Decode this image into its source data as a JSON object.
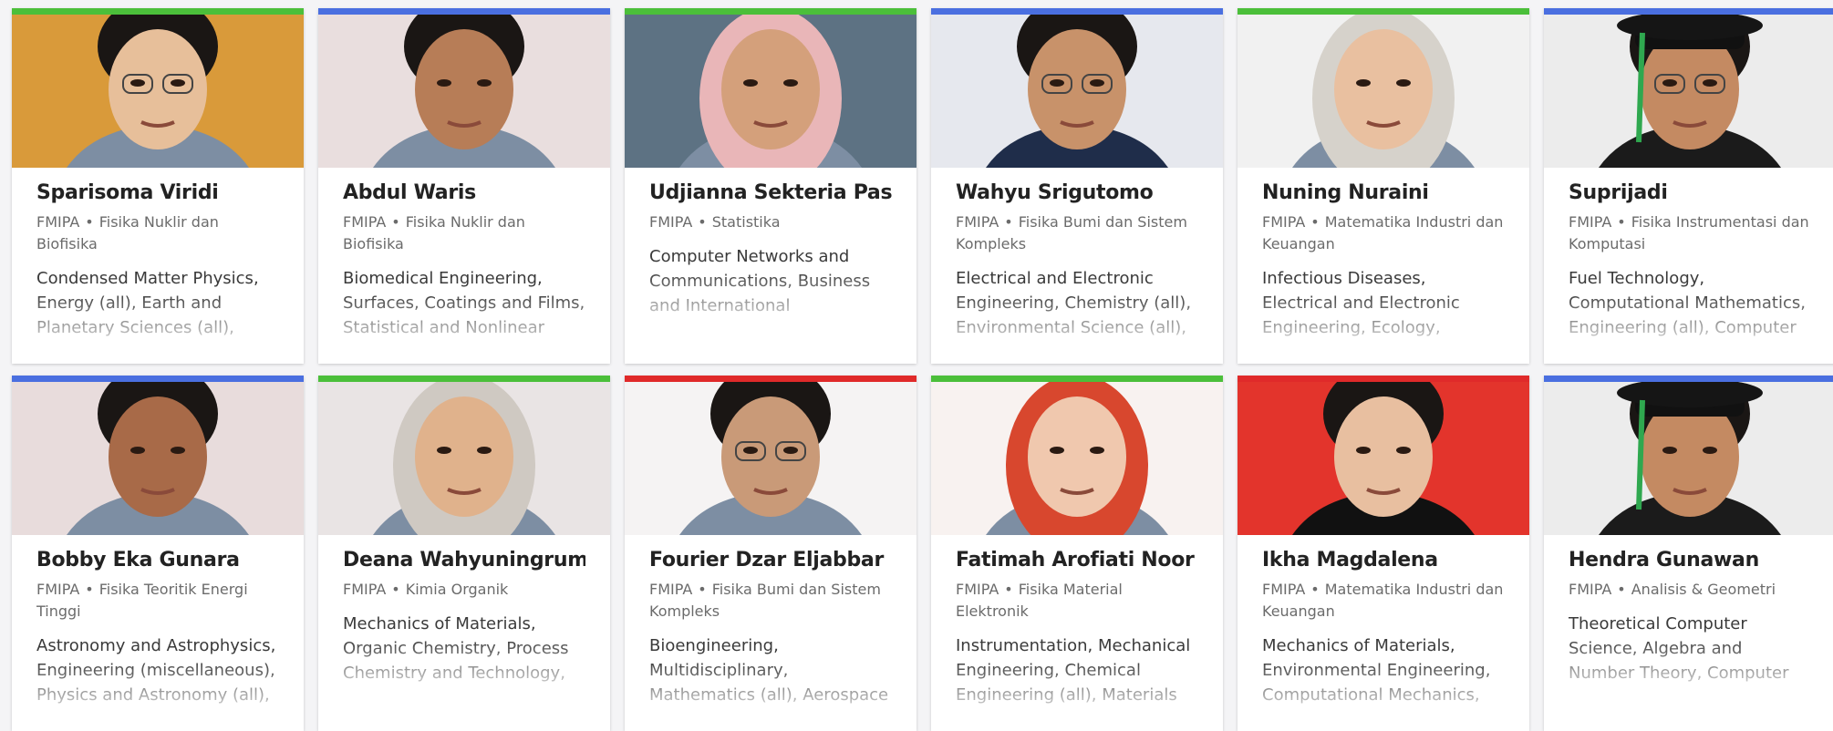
{
  "profiles": [
    {
      "name": "Sparisoma Viridi",
      "faculty": "FMIPA",
      "separator": "•",
      "program": "Fisika Nuklir dan Biofisika",
      "topics": "Condensed Matter Physics, Energy (all), Earth and Planetary Sciences (all),",
      "accent": "#4bbf3a",
      "photo_bg": "#d99a3a"
    },
    {
      "name": "Abdul Waris",
      "faculty": "FMIPA",
      "separator": "•",
      "program": "Fisika Nuklir dan Biofisika",
      "topics": "Biomedical Engineering, Surfaces, Coatings and Films, Statistical and Nonlinear",
      "accent": "#4a6fe0",
      "photo_bg": "#e9dede"
    },
    {
      "name": "Udjianna Sekteria Pasaribu",
      "faculty": "FMIPA",
      "separator": "•",
      "program": "Statistika",
      "topics": "Computer Networks and Communications, Business and International Management, Business,",
      "accent": "#4bbf3a",
      "photo_bg": "#5d7283"
    },
    {
      "name": "Wahyu Srigutomo",
      "faculty": "FMIPA",
      "separator": "•",
      "program": "Fisika Bumi dan Sistem Kompleks",
      "topics": "Electrical and Electronic Engineering, Chemistry (all), Environmental Science (all),",
      "accent": "#4a6fe0",
      "photo_bg": "#e6e8ee"
    },
    {
      "name": "Nuning Nuraini",
      "faculty": "FMIPA",
      "separator": "•",
      "program": "Matematika Industri dan Keuangan",
      "topics": "Infectious Diseases, Electrical and Electronic Engineering, Ecology, Evolution, Behavior",
      "accent": "#4bbf3a",
      "photo_bg": "#f1f1f1"
    },
    {
      "name": "Suprijadi",
      "faculty": "FMIPA",
      "separator": "•",
      "program": "Fisika Instrumentasi dan Komputasi",
      "topics": "Fuel Technology, Computational Mathematics, Engineering (all), Computer",
      "accent": "#4a6fe0",
      "photo_bg": "#ececec"
    },
    {
      "name": "Bobby Eka Gunara",
      "faculty": "FMIPA",
      "separator": "•",
      "program": "Fisika Teoritik Energi Tinggi",
      "topics": "Astronomy and Astrophysics, Engineering (miscellaneous), Physics and Astronomy (all),",
      "accent": "#4a6fe0",
      "photo_bg": "#e8dcdc"
    },
    {
      "name": "Deana Wahyuningrum",
      "faculty": "FMIPA",
      "separator": "•",
      "program": "Kimia Organik",
      "topics": "Mechanics of Materials, Organic Chemistry, Process Chemistry and Technology, Water Science and",
      "accent": "#4bbf3a",
      "photo_bg": "#e9e4e4"
    },
    {
      "name": "Fourier Dzar Eljabbar",
      "faculty": "FMIPA",
      "separator": "•",
      "program": "Fisika Bumi dan Sistem Kompleks",
      "topics": "Bioengineering, Multidisciplinary, Mathematics (all), Aerospace",
      "accent": "#e02a2a",
      "photo_bg": "#f5f3f3"
    },
    {
      "name": "Fatimah Arofiati Noor",
      "faculty": "FMIPA",
      "separator": "•",
      "program": "Fisika Material Elektronik",
      "topics": "Instrumentation, Mechanical Engineering, Chemical Engineering (all), Materials",
      "accent": "#4bbf3a",
      "photo_bg": "#f8f2f0"
    },
    {
      "name": "Ikha Magdalena",
      "faculty": "FMIPA",
      "separator": "•",
      "program": "Matematika Industri dan Keuangan",
      "topics": "Mechanics of Materials, Environmental Engineering, Computational Mechanics,",
      "accent": "#e02a2a",
      "photo_bg": "#e3342c"
    },
    {
      "name": "Hendra Gunawan",
      "faculty": "FMIPA",
      "separator": "•",
      "program": "Analisis & Geometri",
      "topics": "Theoretical Computer Science, Algebra and Number Theory, Computer Science Applications, Electrical and",
      "accent": "#4a6fe0",
      "photo_bg": "#ececec"
    }
  ]
}
